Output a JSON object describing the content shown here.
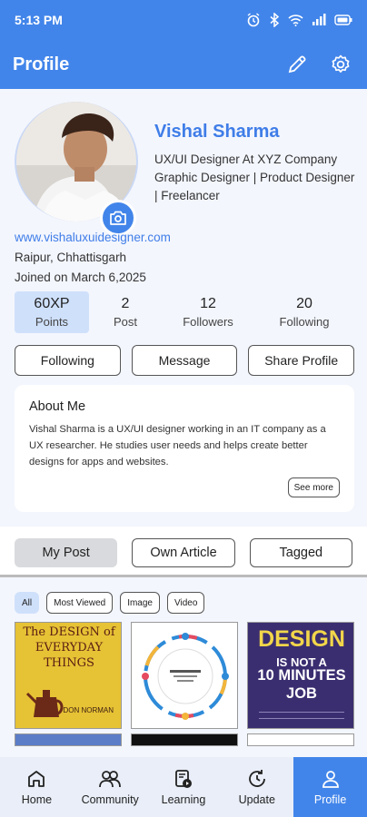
{
  "status_bar": {
    "time": "5:13 PM"
  },
  "app_bar": {
    "title": "Profile"
  },
  "profile": {
    "name": "Vishal Sharma",
    "bio": "UX/UI Designer At XYZ Company Graphic Designer | Product Designer | Freelancer",
    "website": "www.vishaluxuidesigner.com",
    "location": "Raipur, Chhattisgarh",
    "joined": "Joined on March 6,2025"
  },
  "stats": [
    {
      "value": "60XP",
      "label": "Points"
    },
    {
      "value": "2",
      "label": "Post"
    },
    {
      "value": "12",
      "label": "Followers"
    },
    {
      "value": "20",
      "label": "Following"
    }
  ],
  "actions": {
    "following": "Following",
    "message": "Message",
    "share": "Share Profile"
  },
  "about": {
    "title": "About Me",
    "text": "Vishal Sharma is a UX/UI designer working in an IT company as a UX researcher. He studies user needs and helps create better designs for apps and websites.",
    "see_more": "See more"
  },
  "tabs": {
    "my_post": "My Post",
    "own_article": "Own Article",
    "tagged": "Tagged"
  },
  "filters": {
    "all": "All",
    "most_viewed": "Most Viewed",
    "image": "Image",
    "video": "Video"
  },
  "posts": {
    "book1_title": "The DESIGN of EVERYDAY THINGS",
    "book1_author": "DON NORMAN",
    "book3_line1": "DESIGN",
    "book3_line2": "IS NOT A",
    "book3_line3": "10 MINUTES JOB"
  },
  "bottom_nav": {
    "home": "Home",
    "community": "Community",
    "learning": "Learning",
    "update": "Update",
    "profile": "Profile"
  },
  "colors": {
    "primary": "#4285ea",
    "accent_text": "#3f7de8",
    "active_chip": "#cfe0fb"
  }
}
